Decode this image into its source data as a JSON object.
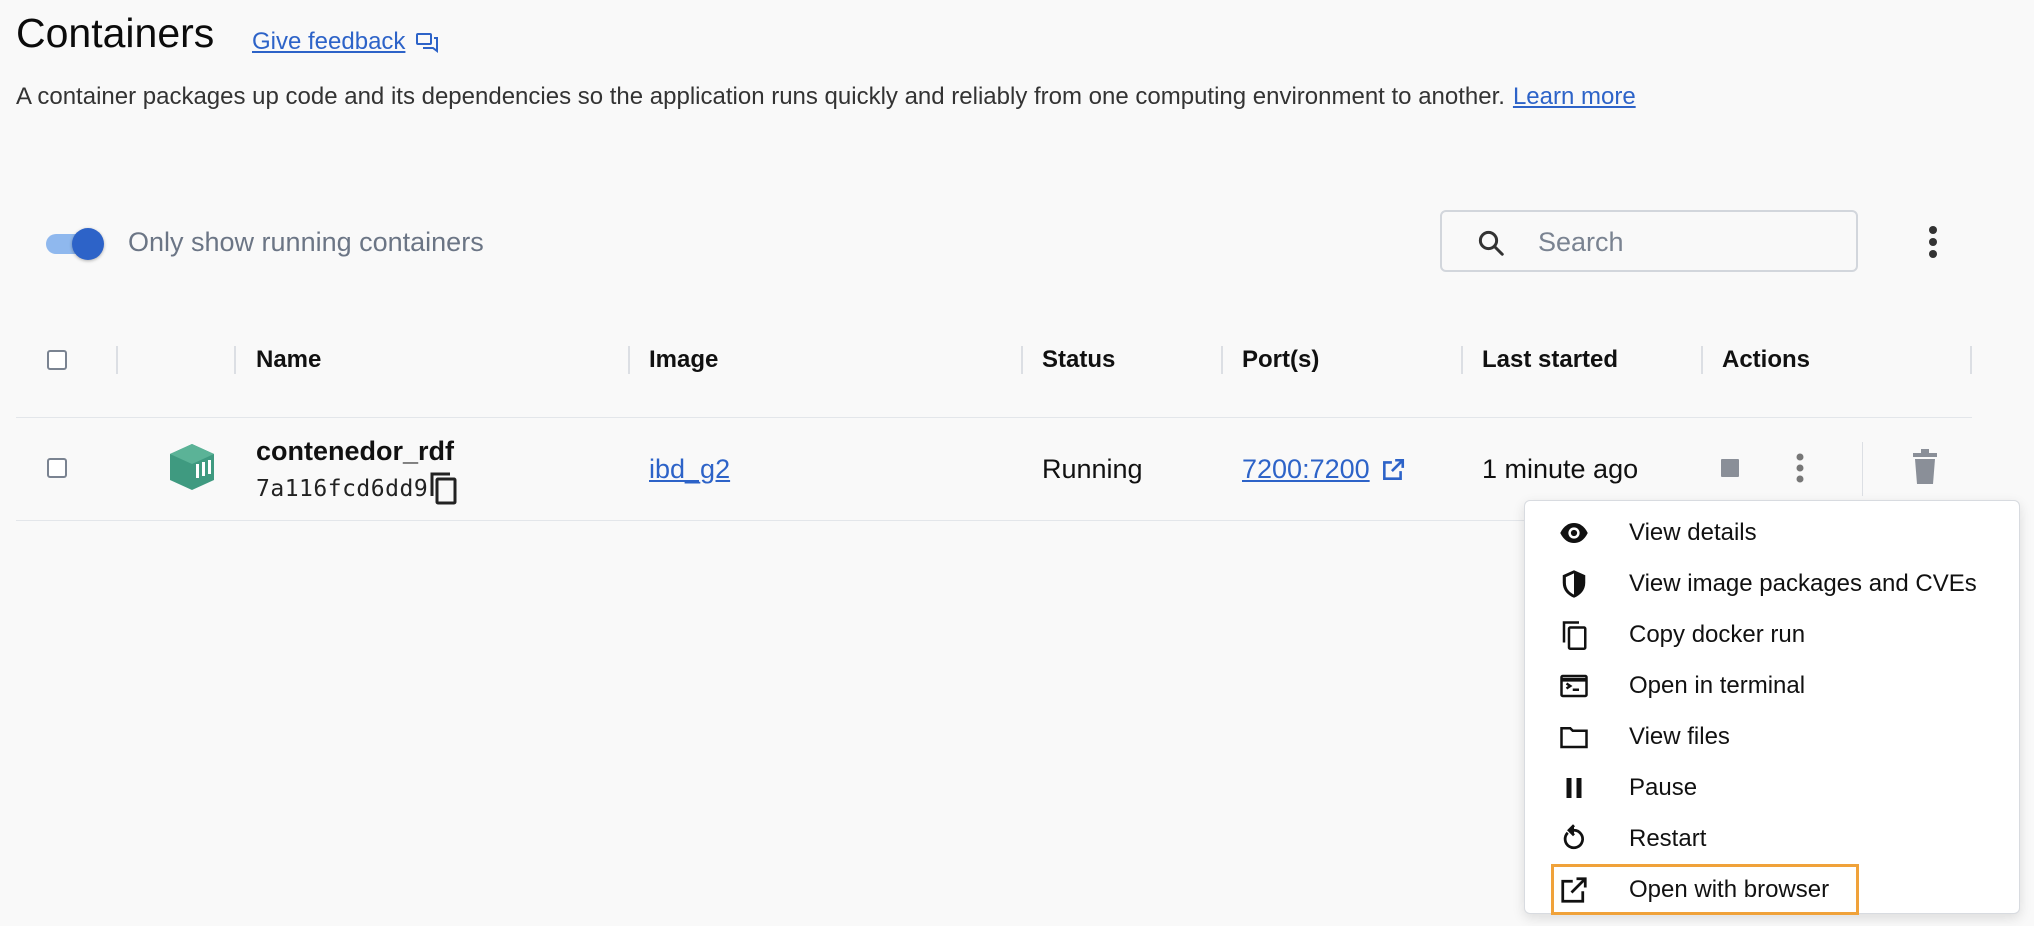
{
  "header": {
    "title": "Containers",
    "feedback_link": "Give feedback",
    "description": "A container packages up code and its dependencies so the application runs quickly and reliably from one computing environment to another.",
    "learn_more": "Learn more"
  },
  "filters": {
    "toggle_label": "Only show running containers",
    "toggle_on": true,
    "search_placeholder": "Search"
  },
  "table": {
    "columns": [
      "Name",
      "Image",
      "Status",
      "Port(s)",
      "Last started",
      "Actions"
    ],
    "rows": [
      {
        "name": "contenedor_rdf",
        "id": "7a116fcd6dd9",
        "image": "ibd_g2",
        "status": "Running",
        "ports": "7200:7200",
        "last_started": "1 minute ago"
      }
    ]
  },
  "context_menu": {
    "items": [
      {
        "label": "View details",
        "icon": "eye-icon"
      },
      {
        "label": "View image packages and CVEs",
        "icon": "shield-icon"
      },
      {
        "label": "Copy docker run",
        "icon": "copy-icon"
      },
      {
        "label": "Open in terminal",
        "icon": "terminal-icon"
      },
      {
        "label": "View files",
        "icon": "folder-icon"
      },
      {
        "label": "Pause",
        "icon": "pause-icon"
      },
      {
        "label": "Restart",
        "icon": "restart-icon"
      },
      {
        "label": "Open with browser",
        "icon": "open-external-icon",
        "highlighted": true
      }
    ]
  },
  "colors": {
    "accent": "#2d63c8",
    "container_icon": "#3f9a80",
    "highlight_outline": "#f0a23a"
  }
}
